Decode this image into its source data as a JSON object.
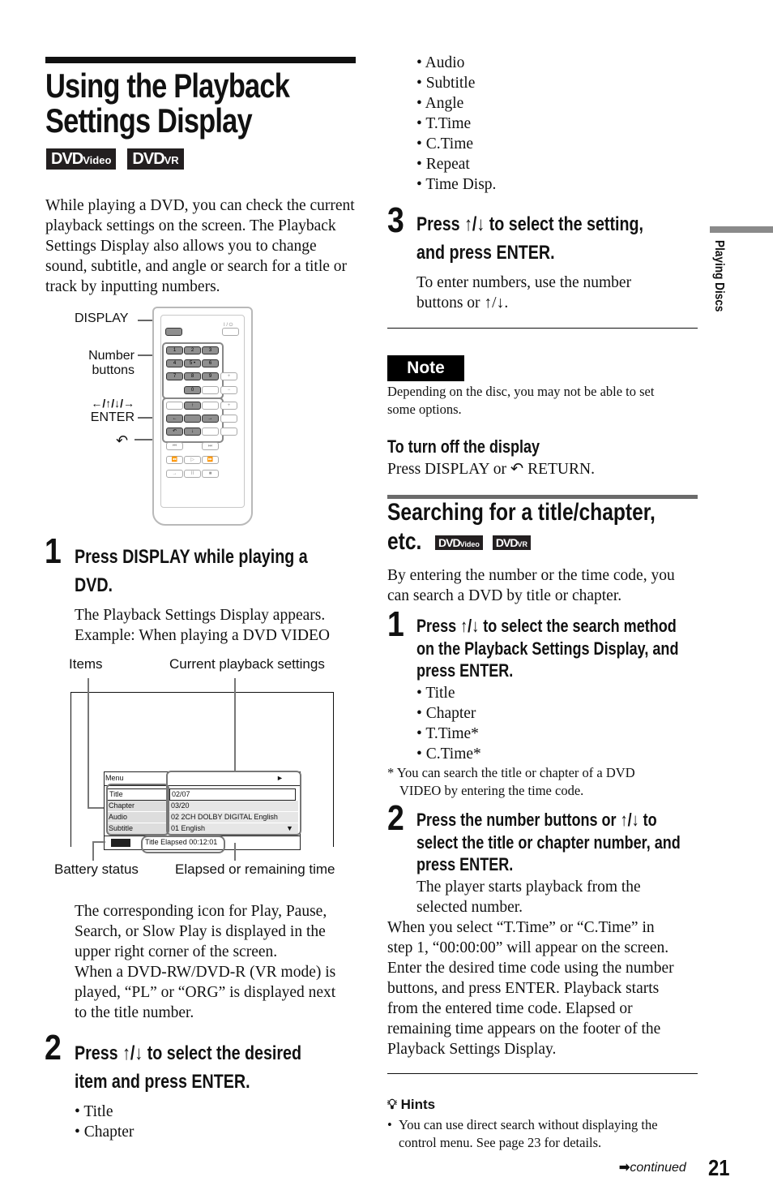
{
  "page": {
    "title_line1": "Using the Playback",
    "title_line2": "Settings Display",
    "badges": [
      {
        "main": "DVD",
        "sub": "Video",
        "icon": "dvd-video-icon"
      },
      {
        "main": "DVD",
        "sub": "VR",
        "icon": "dvd-vr-icon"
      }
    ],
    "intro": "While playing a DVD, you can check the current playback settings on the screen. The Playback Settings Display also allows you to change sound, subtitle, and angle or search for a title or track by inputting numbers.",
    "side_tab": "Playing Discs",
    "page_number": "21",
    "continued": "continued"
  },
  "remote_diagram": {
    "labels": {
      "display": "DISPLAY",
      "number_buttons_1": "Number",
      "number_buttons_2": "buttons",
      "arrows": "←/↑/↓/→",
      "enter": "ENTER",
      "return_icon": "return-icon"
    },
    "power_label": "I / ⏻",
    "number_keys": [
      "1",
      "2",
      "3",
      "4",
      "5 •",
      "6",
      "7",
      "8",
      "9",
      "0"
    ]
  },
  "step1": {
    "number": "1",
    "heading_line1": "Press DISPLAY while playing a",
    "heading_line2": "DVD.",
    "text_line1": "The Playback Settings Display appears.",
    "text_line2": "Example: When playing a DVD VIDEO"
  },
  "osd_diagram": {
    "callouts": {
      "items": "Items",
      "current": "Current playback settings",
      "battery": "Battery status",
      "elapsed": "Elapsed or remaining time"
    },
    "menu_label": "Menu",
    "play_icon": "►",
    "rows": [
      {
        "item": "Title",
        "value": "02/07"
      },
      {
        "item": "Chapter",
        "value": "03/20"
      },
      {
        "item": "Audio",
        "value": "02 2CH DOLBY DIGITAL English"
      },
      {
        "item": "Subtitle",
        "value": "01 English"
      }
    ],
    "scroll_icon": "▼",
    "footer_time": "Title Elapsed 00:12:01"
  },
  "step1_after": [
    "The corresponding icon for Play, Pause,",
    "Search, or Slow Play is displayed in the",
    "upper right corner of the screen.",
    "When a DVD-RW/DVD-R (VR mode) is",
    "played, “PL” or “ORG” is displayed next",
    "to the title number."
  ],
  "step2": {
    "number": "2",
    "heading_line1": "Press ↑/↓ to select the desired",
    "heading_line2": "item and press ENTER.",
    "items": [
      "Title",
      "Chapter",
      "Audio",
      "Subtitle",
      "Angle",
      "T.Time",
      "C.Time",
      "Repeat",
      "Time Disp."
    ]
  },
  "step3": {
    "number": "3",
    "heading_line1": "Press ↑/↓ to select the setting,",
    "heading_line2": "and press ENTER.",
    "text_line1": "To enter numbers, use the number",
    "text_line2": "buttons or ↑/↓."
  },
  "note": {
    "label": "Note",
    "text_line1": "Depending on the disc, you may not be able to set",
    "text_line2": "some options."
  },
  "turn_off": {
    "heading": "To turn off the display",
    "text_pre": "Press DISPLAY or",
    "text_post": "RETURN."
  },
  "search_section": {
    "heading_line1": "Searching for a title/chapter,",
    "heading_line2": "etc.",
    "intro_line1": "By entering the number or the time code, you",
    "intro_line2": "can search a DVD by title or chapter.",
    "step1": {
      "number": "1",
      "heading_lines": [
        "Press ↑/↓ to select the search method",
        "on the Playback Settings Display, and",
        "press ENTER."
      ],
      "items": [
        "Title",
        "Chapter",
        "T.Time*",
        "C.Time*"
      ],
      "footnote_line1": "* You can search the title or chapter of a DVD",
      "footnote_line2": "VIDEO by entering the time code."
    },
    "step2": {
      "number": "2",
      "heading_lines": [
        "Press the number buttons or ↑/↓ to",
        "select the title or chapter number, and",
        "press ENTER."
      ],
      "text_line1": "The player starts playback from the",
      "text_line2": "selected number."
    },
    "para": [
      "When you select “T.Time” or “C.Time” in",
      "step 1, “00:00:00” will appear on the screen.",
      "Enter the desired time code using the number",
      "buttons, and press ENTER. Playback starts",
      "from the entered time code. Elapsed or",
      "remaining time appears on the footer of the",
      "Playback Settings Display."
    ]
  },
  "hints": {
    "label": "Hints",
    "text_line1": "You can use direct search without displaying the",
    "text_line2": "control menu. See page 23 for details."
  }
}
